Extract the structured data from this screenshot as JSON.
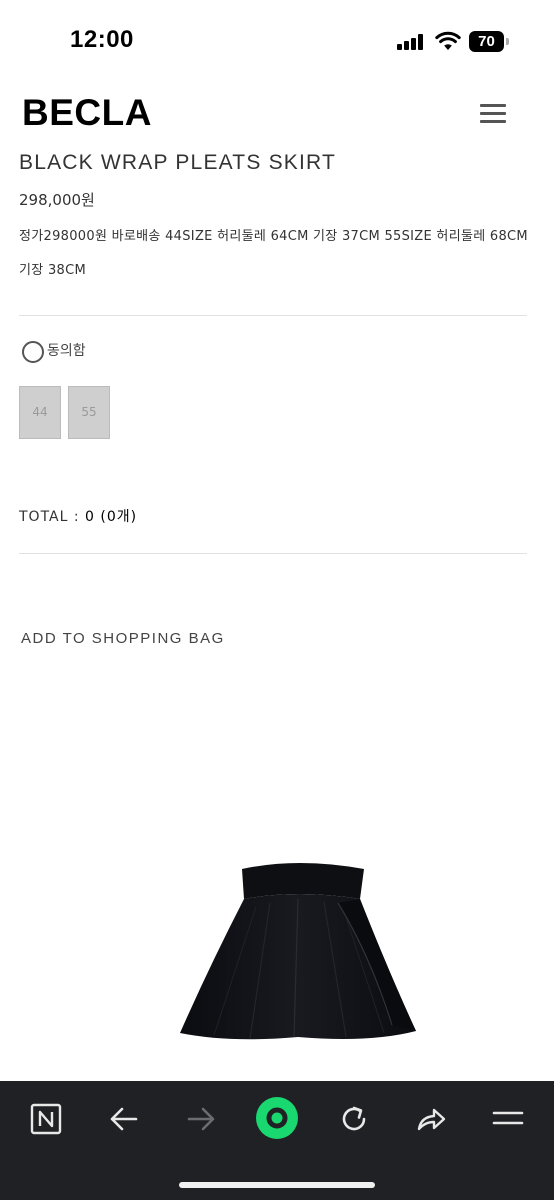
{
  "status_bar": {
    "time": "12:00",
    "battery": "70"
  },
  "header": {
    "brand": "BECLA",
    "menu_icon": "hamburger-menu-icon"
  },
  "product": {
    "title": "BLACK WRAP PLEATS SKIRT",
    "price": "298,000원",
    "description": "정가298000원 바로배송 44SIZE 허리둘레 64CM 기장 37CM 55SIZE 허리둘레 68CM 기장 38CM",
    "agree_label": "동의함",
    "sizes": [
      "44",
      "55"
    ],
    "total_label": "TOTAL : ",
    "total_value": "0 (0개)",
    "add_to_bag": "ADD TO SHOPPING BAG",
    "image_icon": "black-pleated-skirt-image"
  },
  "browser_bar": {
    "buttons": [
      "naver-n-icon",
      "back-arrow-icon",
      "forward-arrow-icon",
      "green-home-icon",
      "reload-icon",
      "share-icon",
      "menu-icon"
    ],
    "accent": "#19d86f",
    "background": "#1f2124"
  }
}
